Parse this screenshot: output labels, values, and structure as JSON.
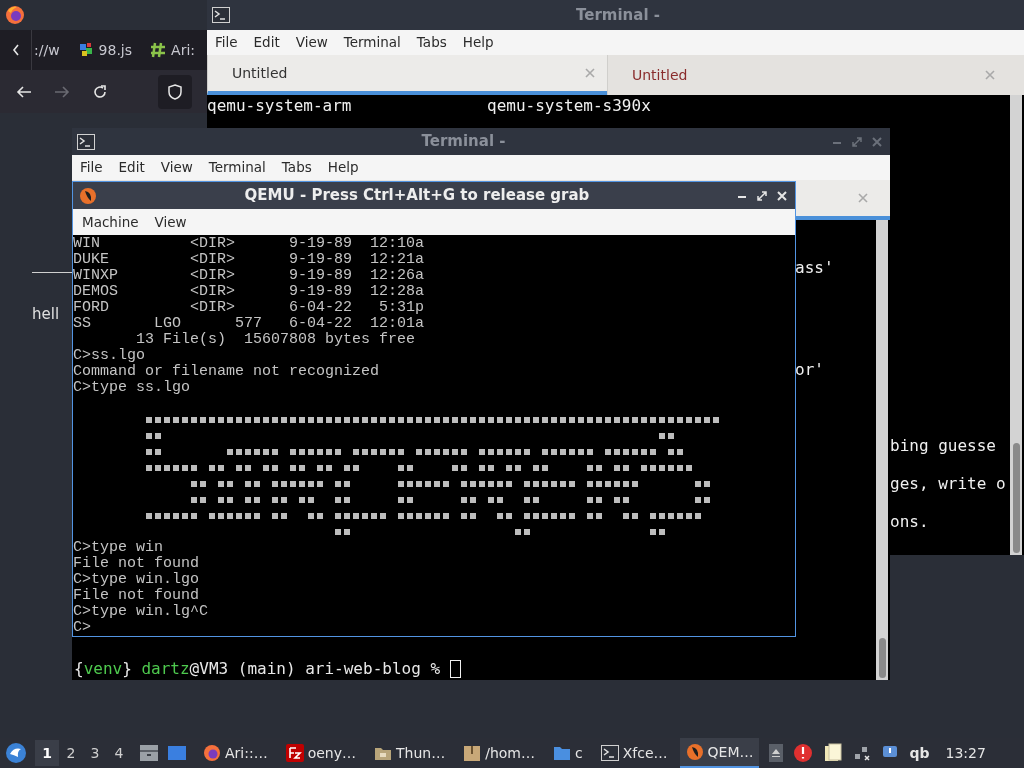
{
  "browser": {
    "tabs": [
      {
        "label": "://w",
        "kind": "plain"
      },
      {
        "label": "98.js",
        "kind": "colorful"
      },
      {
        "label": "Ari:",
        "kind": "hash"
      }
    ],
    "page_lines": [
      "hell"
    ]
  },
  "back_terminal": {
    "title": "Terminal -",
    "menu": [
      "File",
      "Edit",
      "View",
      "Terminal",
      "Tabs",
      "Help"
    ],
    "tabs": [
      {
        "label": "Untitled",
        "selected": true
      },
      {
        "label": "Untitled",
        "selected": false
      }
    ],
    "columns": [
      [
        "qemu-system-arm"
      ],
      [
        "qemu-system-s390x"
      ]
    ],
    "tail_lines": [
      "bing guesse",
      "ges, write o",
      "ons."
    ]
  },
  "middle_terminal": {
    "title": "Terminal -",
    "menu": [
      "File",
      "Edit",
      "View",
      "Terminal",
      "Tabs",
      "Help"
    ],
    "tail_lines": [
      "ass'",
      "or'"
    ],
    "prompt": [
      {
        "text": "{",
        "color": "#e8e8e8"
      },
      {
        "text": "venv",
        "color": "#4ec94e"
      },
      {
        "text": "} ",
        "color": "#e8e8e8"
      },
      {
        "text": "dartz",
        "color": "#4ec94e"
      },
      {
        "text": "@VM3 (main) ari-web-blog % ",
        "color": "#e8e8e8"
      }
    ]
  },
  "qemu": {
    "title": "QEMU - Press Ctrl+Alt+G to release grab",
    "menu": [
      "Machine",
      "View"
    ],
    "console": [
      {
        "kind": "text",
        "text": "WIN          <DIR>      9-19-89  12:10a"
      },
      {
        "kind": "text",
        "text": "DUKE         <DIR>      9-19-89  12:21a"
      },
      {
        "kind": "text",
        "text": "WINXP        <DIR>      9-19-89  12:26a"
      },
      {
        "kind": "text",
        "text": "DEMOS        <DIR>      9-19-89  12:28a"
      },
      {
        "kind": "text",
        "text": "FORD         <DIR>      6-04-22   5:31p"
      },
      {
        "kind": "text",
        "text": "SS       LGO      577   6-04-22  12:01a"
      },
      {
        "kind": "text",
        "text": "       13 File(s)  15607808 bytes free"
      },
      {
        "kind": "text",
        "text": "C>ss.lgo"
      },
      {
        "kind": "text",
        "text": "Command or filename not recognized"
      },
      {
        "kind": "text",
        "text": "C>type ss.lgo"
      },
      {
        "kind": "art"
      },
      {
        "kind": "text",
        "text": "C>type win"
      },
      {
        "kind": "text",
        "text": "File not found"
      },
      {
        "kind": "text",
        "text": "C>type win.lgo"
      },
      {
        "kind": "text",
        "text": "File not found"
      },
      {
        "kind": "text",
        "text": "C>type win.lg^C"
      },
      {
        "kind": "text",
        "text": "C>"
      }
    ]
  },
  "taskbar": {
    "workspaces": [
      {
        "label": "1",
        "selected": true
      },
      {
        "label": "2",
        "selected": false
      },
      {
        "label": "3",
        "selected": false
      },
      {
        "label": "4",
        "selected": false
      }
    ],
    "tasks": [
      {
        "label": "Ari::…",
        "kind": "firefox",
        "selected": false
      },
      {
        "label": "oeny…",
        "kind": "filezilla",
        "selected": false
      },
      {
        "label": "Thun…",
        "kind": "thunar",
        "selected": false
      },
      {
        "label": "/hom…",
        "kind": "archive",
        "selected": false
      },
      {
        "label": "c",
        "kind": "folder",
        "selected": false
      },
      {
        "label": "Xfce…",
        "kind": "terminal",
        "selected": false
      },
      {
        "label": "QEM…",
        "kind": "qemu",
        "selected": true
      }
    ],
    "keyboard_layout": "qb",
    "clock": "13:27"
  }
}
